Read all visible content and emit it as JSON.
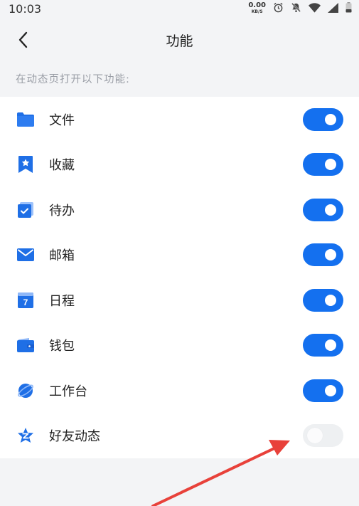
{
  "status_bar": {
    "time": "10:03",
    "net_speed": "0.00",
    "net_unit": "KB/S",
    "icons": [
      "alarm-icon",
      "mute-icon",
      "wifi-icon",
      "signal-icon",
      "battery-icon"
    ]
  },
  "header": {
    "title": "功能",
    "back_icon": "chevron-left-icon"
  },
  "section_hint": "在动态页打开以下功能:",
  "features": [
    {
      "label": "文件",
      "icon": "folder-icon",
      "enabled": true
    },
    {
      "label": "收藏",
      "icon": "bookmark-star-icon",
      "enabled": true
    },
    {
      "label": "待办",
      "icon": "todo-check-icon",
      "enabled": true
    },
    {
      "label": "邮箱",
      "icon": "mail-icon",
      "enabled": true
    },
    {
      "label": "日程",
      "icon": "calendar-icon",
      "enabled": true
    },
    {
      "label": "钱包",
      "icon": "wallet-icon",
      "enabled": true
    },
    {
      "label": "工作台",
      "icon": "planet-icon",
      "enabled": true
    },
    {
      "label": "好友动态",
      "icon": "qzone-star-icon",
      "enabled": false
    }
  ],
  "calendar_day": "7",
  "colors": {
    "accent": "#1470ef",
    "toggle_off": "#eef0f2",
    "background": "#f3f4f6",
    "annotation_arrow": "#e8413a"
  }
}
